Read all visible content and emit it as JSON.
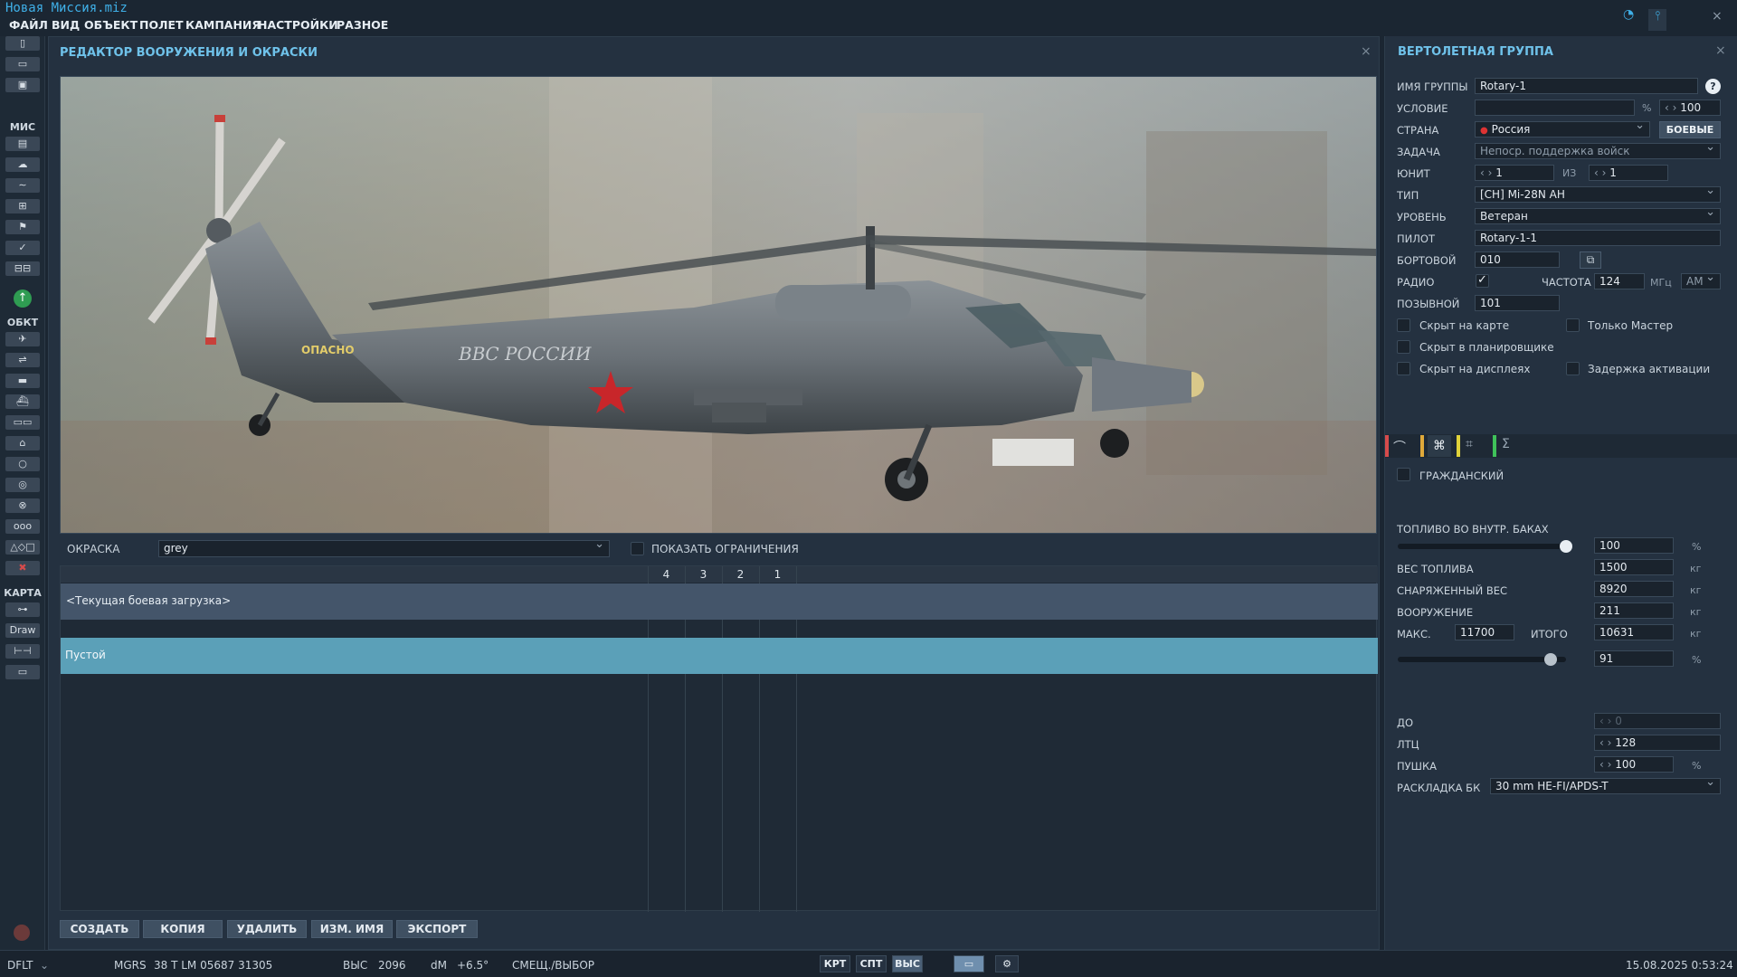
{
  "app": {
    "title": "Новая Миссия.miz"
  },
  "menu": [
    "ФАЙЛ",
    "ВИД",
    "ОБЪЕКТ",
    "ПОЛЕТ",
    "КАМПАНИЯ",
    "НАСТРОЙКИ",
    "РАЗНОЕ"
  ],
  "left_toolbar": {
    "sections": {
      "mission": "МИС",
      "objects": "ОБКТ",
      "map": "КАРТА"
    },
    "draw_label": "Draw"
  },
  "editor": {
    "title": "РЕДАКТОР ВООРУЖЕНИЯ И ОКРАСКИ",
    "livery_label": "ОКРАСКА",
    "livery_value": "grey",
    "show_limits_label": "ПОКАЗАТЬ ОГРАНИЧЕНИЯ",
    "preview": {
      "tail_text": "ОПАСНО",
      "fuselage_text": "ВВС РОССИИ"
    },
    "table": {
      "station_headers": [
        "4",
        "3",
        "2",
        "1"
      ],
      "rows": [
        {
          "name": "<Текущая боевая загрузка>"
        },
        {
          "name": "Пустой"
        }
      ]
    },
    "buttons": {
      "create": "СОЗДАТЬ",
      "copy": "КОПИЯ",
      "delete": "УДАЛИТЬ",
      "rename": "ИЗМ. ИМЯ",
      "export": "ЭКСПОРТ"
    }
  },
  "group": {
    "title": "ВЕРТОЛЕТНАЯ ГРУППА",
    "name_label": "ИМЯ ГРУППЫ",
    "name_value": "Rotary-1",
    "help": "?",
    "condition_label": "УСЛОВИЕ",
    "condition_pct": "%",
    "condition_value": "100",
    "country_label": "СТРАНА",
    "country_value": "Россия",
    "combat_button": "БОЕВЫЕ",
    "task_label": "ЗАДАЧА",
    "task_value": "Непоср. поддержка войск",
    "unit_label": "ЮНИТ",
    "unit_value": "1",
    "unit_of": "ИЗ",
    "unit_total": "1",
    "type_label": "ТИП",
    "type_value": "[CH] Mi-28N AH",
    "skill_label": "УРОВЕНЬ",
    "skill_value": "Ветеран",
    "pilot_label": "ПИЛОТ",
    "pilot_value": "Rotary-1-1",
    "tail_label": "БОРТОВОЙ",
    "tail_value": "010",
    "radio_label": "РАДИО",
    "radio_checked": true,
    "freq_label": "ЧАСТОТА",
    "freq_value": "124",
    "freq_unit": "МГц",
    "modulation": "AM",
    "callsign_label": "ПОЗЫВНОЙ",
    "callsign_value": "101",
    "checkboxes": {
      "hidden_map": "Скрыт на карте",
      "master_only": "Только Мастер",
      "hidden_planner": "Скрыт в планировщике",
      "hidden_displays": "Скрыт на дисплеях",
      "late_activation": "Задержка активации"
    },
    "civil_label": "ГРАЖДАНСКИЙ",
    "fuel_internal_label": "ТОПЛИВО ВО ВНУТР. БАКАХ",
    "fuel_pct": "100",
    "fuel_pct_fraction": 1.0,
    "fuel_weight_label": "ВЕС ТОПЛИВА",
    "fuel_weight": "1500",
    "empty_weight_label": "СНАРЯЖЕННЫЙ ВЕС",
    "empty_weight": "8920",
    "weapons_label": "ВООРУЖЕНИЕ",
    "weapons_weight": "211",
    "max_label": "МАКС.",
    "max_weight": "11700",
    "total_label": "ИТОГО",
    "total_weight": "10631",
    "total_pct": "91",
    "total_pct_fraction": 0.91,
    "units": {
      "pct": "%",
      "kg": "кг"
    },
    "chaff_label": "ДО",
    "chaff_value": "0",
    "flare_label": "ЛТЦ",
    "flare_value": "128",
    "gun_label": "ПУШКА",
    "gun_value": "100",
    "ammo_label": "РАСКЛАДКА БК",
    "ammo_value": "30 mm HE-FI/APDS-T",
    "tab_colors": [
      "#d64b4b",
      "#e0a93a",
      "#e0d23a",
      "#3fc25a"
    ]
  },
  "status": {
    "profile": "DFLT",
    "grid_label": "MGRS",
    "grid_value": "38 T LM 05687 31305",
    "alt_label": "ВЫС",
    "alt_value": "2096",
    "dm_label": "dM",
    "dm_value": "+6.5°",
    "mode": "СМЕЩ./ВЫБОР",
    "view_buttons": [
      "КРТ",
      "СПТ",
      "ВЫС"
    ],
    "datetime": "15.08.2025 0:53:24"
  }
}
